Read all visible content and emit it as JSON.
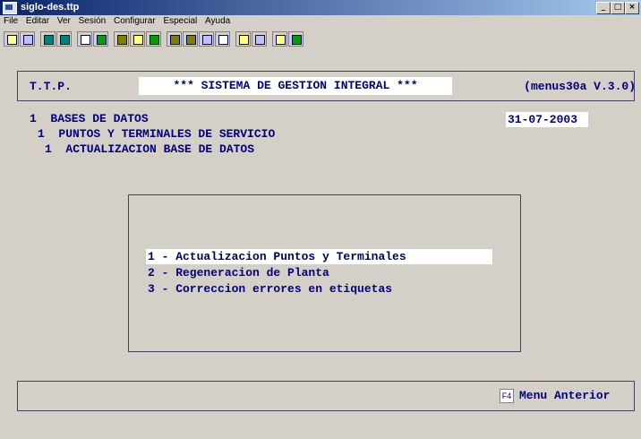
{
  "window": {
    "title": "siglo-des.ttp",
    "buttons": [
      "_",
      "□",
      "×"
    ]
  },
  "menubar": [
    "File",
    "Editar",
    "Ver",
    "Sesión",
    "Configurar",
    "Especial",
    "Ayuda"
  ],
  "header": {
    "left": "T.T.P.",
    "center": "***  SISTEMA DE GESTION INTEGRAL  ***",
    "right": "(menus30a  V.3.0)"
  },
  "breadcrumb": {
    "level1": "1  BASES DE DATOS",
    "level2": "1  PUNTOS Y TERMINALES DE SERVICIO",
    "level3": "1  ACTUALIZACION BASE DE DATOS"
  },
  "date": "31-07-2003",
  "menu": {
    "options": [
      "1 - Actualizacion Puntos y Terminales",
      "2 - Regeneracion de Planta",
      "3 - Correccion errores en etiquetas"
    ],
    "selected_index": 0
  },
  "footer": {
    "key": "F4",
    "label": "Menu Anterior"
  }
}
